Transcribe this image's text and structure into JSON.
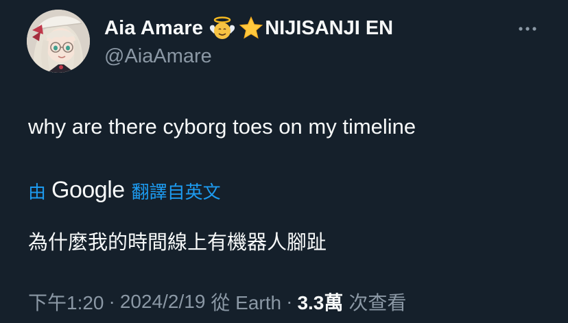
{
  "author": {
    "display_name": "Aia Amare",
    "org_label": "NIJISANJI EN",
    "handle": "@AiaAmare",
    "badges": [
      "angel-emoji",
      "star-emoji"
    ]
  },
  "tweet": {
    "text": "why are there cyborg toes on my timeline"
  },
  "translation": {
    "by_label": "由",
    "provider": "Google",
    "from_label": "翻譯自英文",
    "text": "為什麼我的時間線上有機器人腳趾"
  },
  "meta": {
    "time": "下午1:20",
    "dot1": "·",
    "date": "2024/2/19",
    "source": "從 Earth",
    "dot2": "·",
    "views_count": "3.3萬",
    "views_label": "次查看"
  },
  "colors": {
    "background": "#15202b",
    "text_primary": "#f7f9f9",
    "text_secondary": "#8b98a5",
    "accent": "#1d9bf0"
  },
  "icons": {
    "more": "more-horizontal-icon"
  }
}
